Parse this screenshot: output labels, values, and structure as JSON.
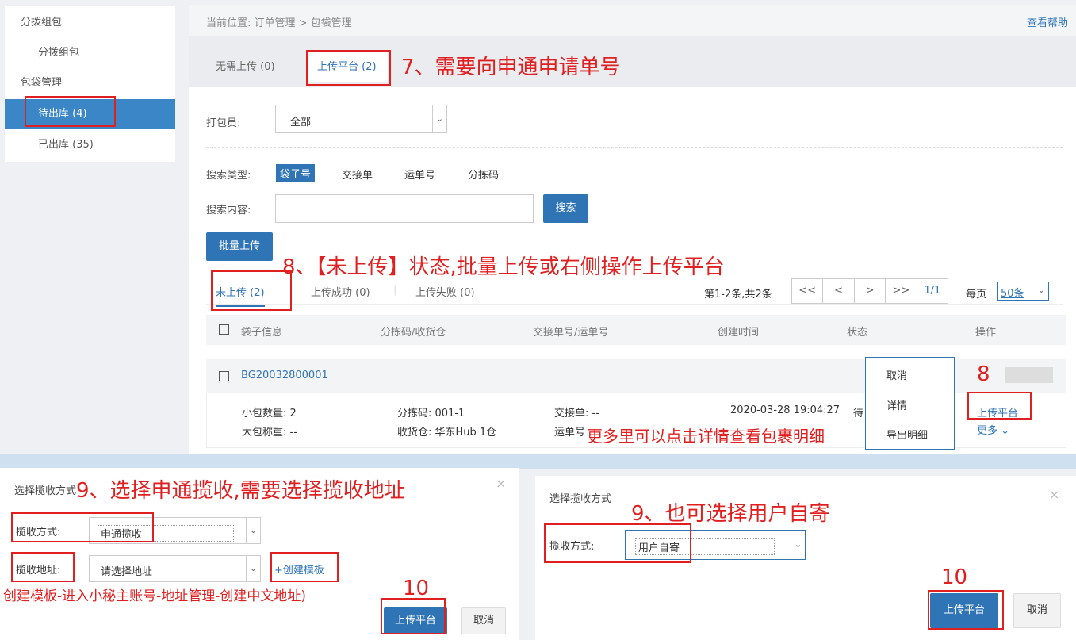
{
  "sidebar": {
    "group1": "分拨组包",
    "item1": "分拨组包",
    "group2": "包袋管理",
    "item_active": "待出库 (4)",
    "item3": "已出库 (35)"
  },
  "breadcrumb": {
    "text": "当前位置:  订单管理 > 包袋管理",
    "help": "查看帮助"
  },
  "top_tabs": {
    "tab1": "无需上传 (0)",
    "tab2": "上传平台 (2)"
  },
  "filters": {
    "packer_label": "打包员:",
    "packer_value": "全部",
    "search_type_label": "搜索类型:",
    "search_types": [
      "袋子号",
      "交接单",
      "运单号",
      "分拣码"
    ],
    "search_content_label": "搜索内容:",
    "search_button": "搜索",
    "batch_upload": "批量上传"
  },
  "sub_tabs": {
    "tab1": "未上传 (2)",
    "tab2": "上传成功 (0)",
    "tab3": "上传失败 (0)"
  },
  "pagination": {
    "summary": "第1-2条,共2条",
    "first": "<<",
    "prev": "<",
    "next": ">",
    "last": ">>",
    "page": "1/1",
    "per_page_label": "每页",
    "per_page_value": "50条"
  },
  "table": {
    "headers": [
      "袋子信息",
      "分拣码/收货仓",
      "交接单号/运单号",
      "创建时间",
      "状态",
      "操作"
    ],
    "row": {
      "bag_no": "BG20032800001",
      "small_qty": "小包数量: 2",
      "big_weight": "大包称重: --",
      "sort_code": "分拣码: 001-1",
      "warehouse": "收货仓: 华东Hub 1仓",
      "handover": "交接单: --",
      "waybill": "运单号",
      "created": "2020-03-28 19:04:27",
      "status": "待",
      "upload_link": "上传平台",
      "more_link": "更多"
    }
  },
  "dropdown": {
    "items": [
      "取消",
      "详情",
      "导出明细"
    ]
  },
  "dialog_left": {
    "title": "选择揽收方式",
    "method_label": "揽收方式:",
    "method_value": "申通揽收",
    "address_label": "揽收地址:",
    "address_placeholder": "请选择地址",
    "create_template": "+创建模板",
    "ok": "上传平台",
    "cancel": "取消"
  },
  "dialog_right": {
    "title": "选择揽收方式",
    "method_label": "揽收方式:",
    "method_value": "用户自寄",
    "ok": "上传平台",
    "cancel": "取消"
  },
  "annotations": {
    "a7": "7、需要向申通申请单号",
    "a8": "8、【未上传】状态,批量上传或右侧操作上传平台",
    "a8b": "8",
    "a_more": "更多里可以点击详情查看包裹明细",
    "a9_left": "9、选择申通揽收,需要选择揽收地址",
    "a_template": "创建模板-进入小秘主账号-地址管理-创建中文地址)",
    "a10_left": "10",
    "a9_right": "9、也可选择用户自寄",
    "a10_right": "10"
  },
  "colors": {
    "accent": "#2f74b5",
    "annotation": "#e02020",
    "sidebar_active": "#3a86c6"
  }
}
